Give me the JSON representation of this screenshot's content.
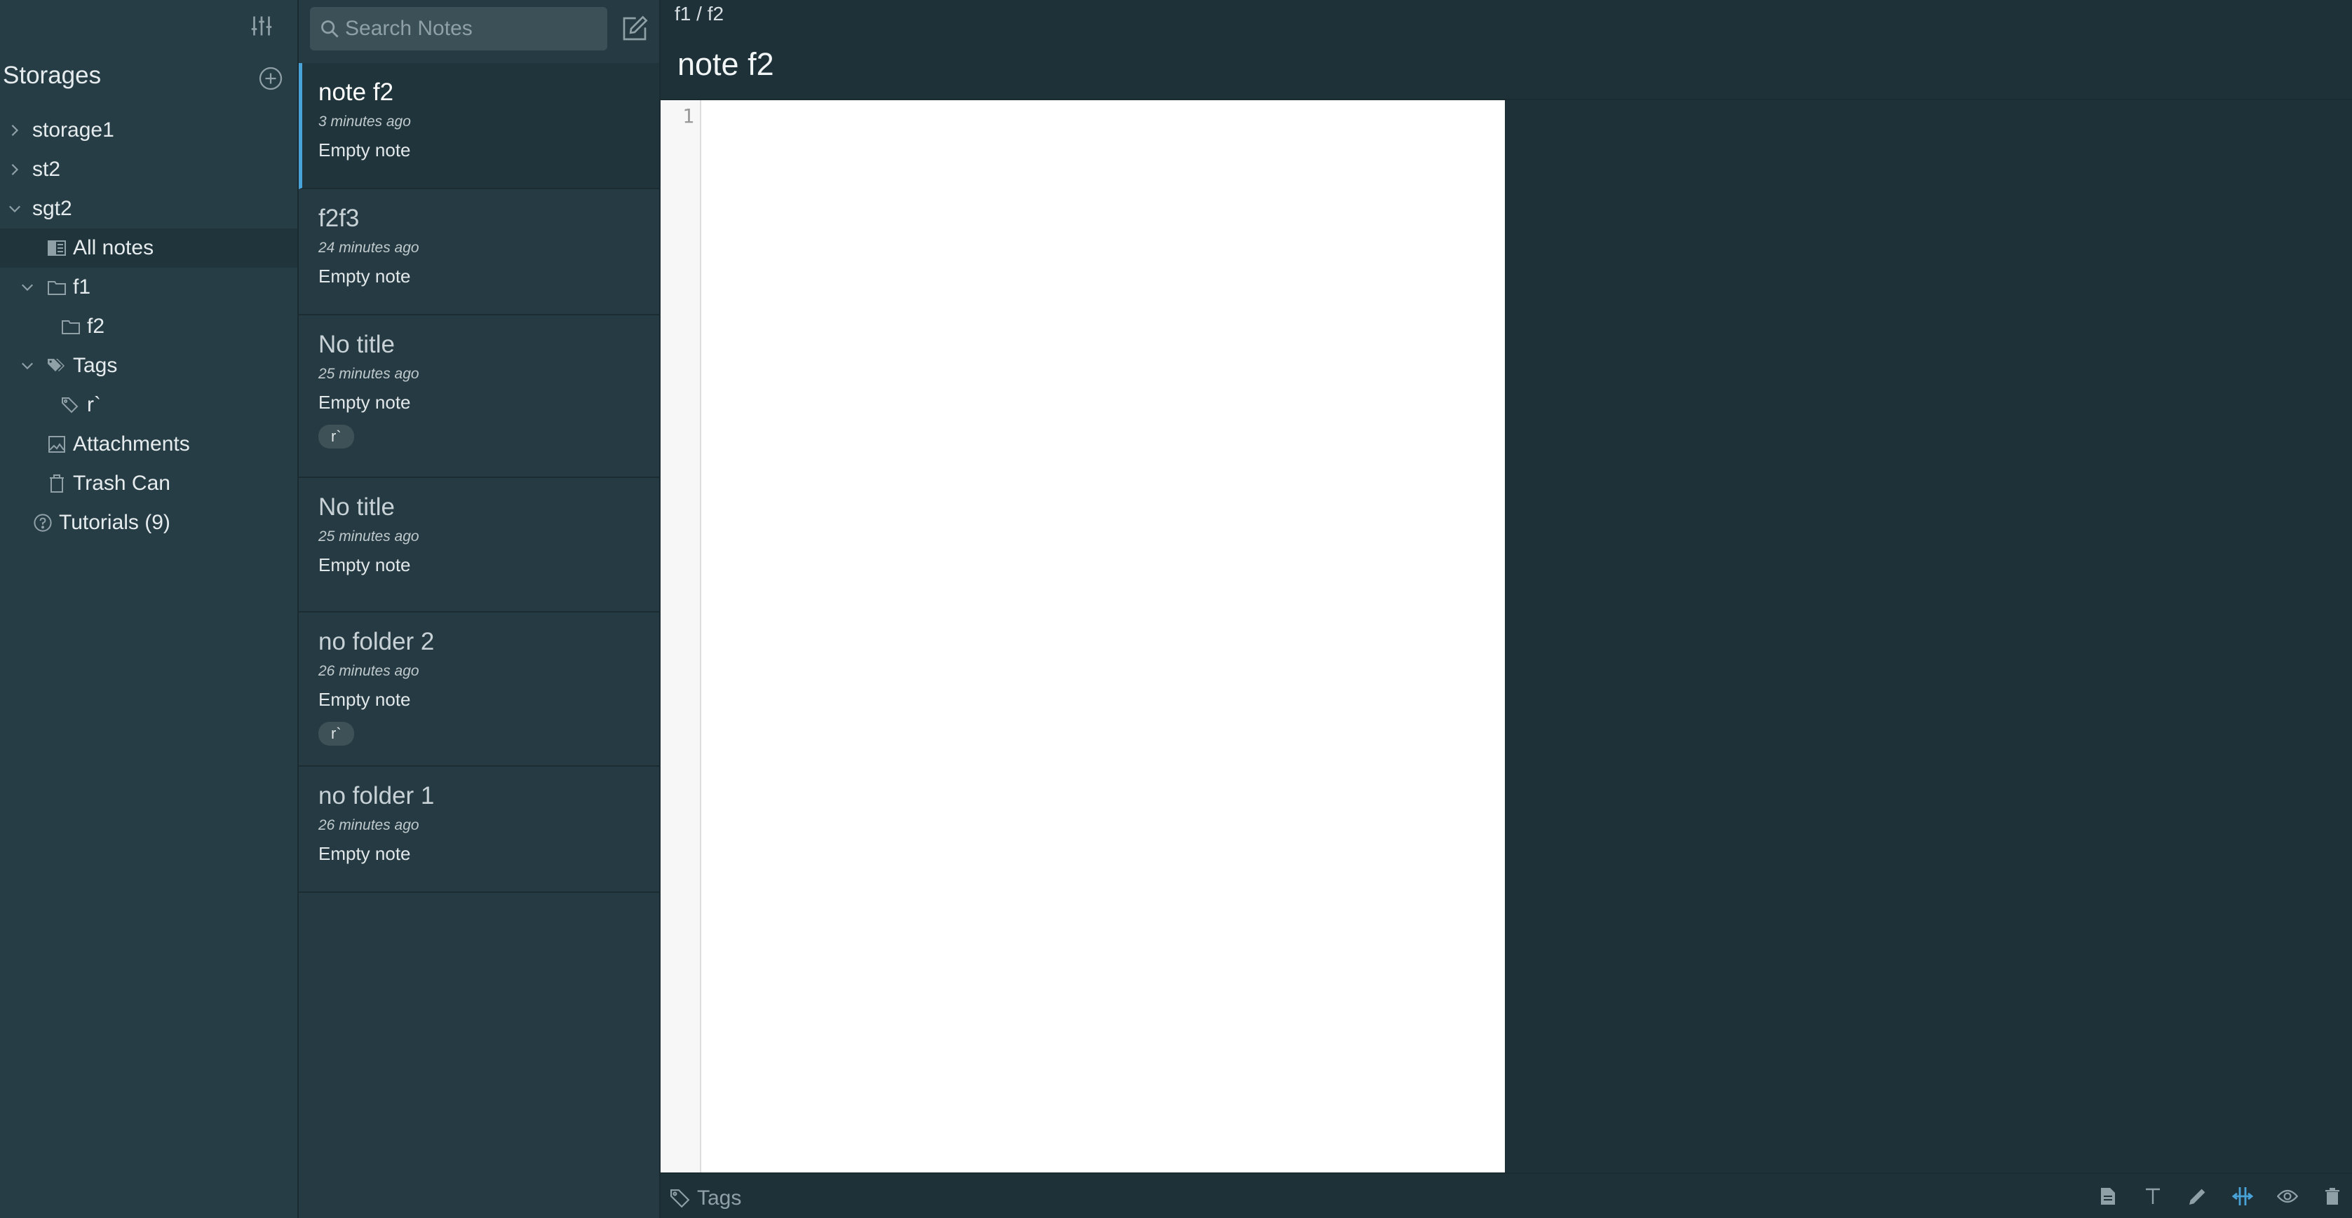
{
  "sidebar": {
    "title": "Storages",
    "items": [
      {
        "label": "storage1"
      },
      {
        "label": "st2"
      },
      {
        "label": "sgt2"
      },
      {
        "label": "All notes"
      },
      {
        "label": "f1"
      },
      {
        "label": "f2"
      },
      {
        "label": "Tags"
      },
      {
        "label": "r`"
      },
      {
        "label": "Attachments"
      },
      {
        "label": "Trash Can"
      },
      {
        "label": "Tutorials (9)"
      }
    ]
  },
  "search": {
    "placeholder": "Search Notes"
  },
  "notes": [
    {
      "title": "note f2",
      "time": "3 minutes ago",
      "preview": "Empty note",
      "tag": ""
    },
    {
      "title": "f2f3",
      "time": "24 minutes ago",
      "preview": "Empty note",
      "tag": ""
    },
    {
      "title": "No title",
      "time": "25 minutes ago",
      "preview": "Empty note",
      "tag": "r`"
    },
    {
      "title": "No title",
      "time": "25 minutes ago",
      "preview": "Empty note",
      "tag": ""
    },
    {
      "title": "no folder 2",
      "time": "26 minutes ago",
      "preview": "Empty note",
      "tag": "r`"
    },
    {
      "title": "no folder 1",
      "time": "26 minutes ago",
      "preview": "Empty note",
      "tag": ""
    }
  ],
  "detail": {
    "breadcrumb": "f1 / f2",
    "title": "note f2",
    "line_number": "1",
    "tags_placeholder": "Tags"
  },
  "colors": {
    "accent": "#4aa3d8",
    "sidebar_bg": "#263d45",
    "main_bg": "#1e3139"
  }
}
